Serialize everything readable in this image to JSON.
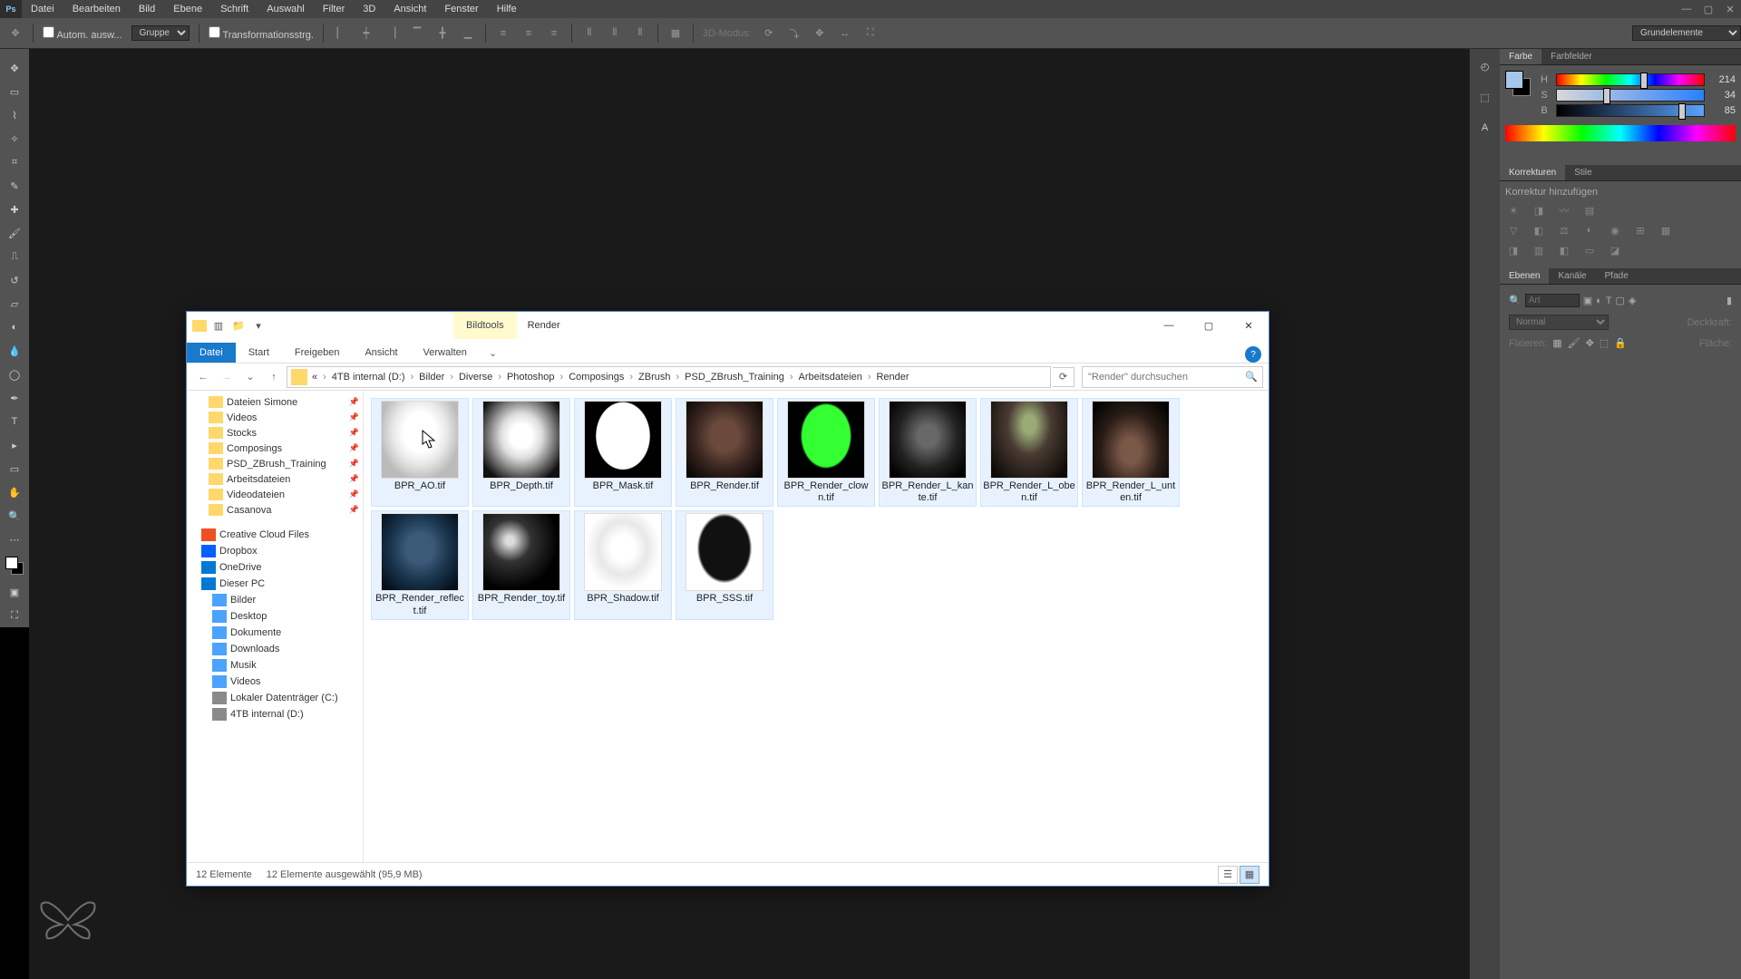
{
  "ps": {
    "logo": "Ps",
    "menu": [
      "Datei",
      "Bearbeiten",
      "Bild",
      "Ebene",
      "Schrift",
      "Auswahl",
      "Filter",
      "3D",
      "Ansicht",
      "Fenster",
      "Hilfe"
    ],
    "opt_auto": "Autom. ausw...",
    "opt_group": "Gruppe",
    "opt_trans": "Transformationsstrg.",
    "opt_3d": "3D-Modus:",
    "opt_preset": "Grundelemente",
    "color_tab": "Farbe",
    "swatch_tab": "Farbfelder",
    "h": {
      "lbl": "H",
      "val": "214"
    },
    "s": {
      "lbl": "S",
      "val": "34"
    },
    "b": {
      "lbl": "B",
      "val": "85"
    },
    "adj_tab": "Korrekturen",
    "styles_tab": "Stile",
    "adj_add": "Korrektur hinzufügen",
    "layers_tab": "Ebenen",
    "channels_tab": "Kanäle",
    "paths_tab": "Pfade",
    "search_ph": "Art",
    "blend": "Normal",
    "opacity_lbl": "Deckkraft:",
    "lock_lbl": "Fixieren:",
    "fill_lbl": "Fläche:"
  },
  "ex": {
    "tooltab": "Bildtools",
    "title": "Render",
    "ribbon_file": "Datei",
    "ribbon": [
      "Start",
      "Freigeben",
      "Ansicht"
    ],
    "ribbon_tool": "Verwalten",
    "crumbs_pre": "«",
    "crumbs": [
      "4TB internal (D:)",
      "Bilder",
      "Diverse",
      "Photoshop",
      "Composings",
      "ZBrush",
      "PSD_ZBrush_Training",
      "Arbeitsdateien",
      "Render"
    ],
    "search_ph": "\"Render\" durchsuchen",
    "tree": [
      {
        "ind": 16,
        "ico": "f",
        "label": "Dateien Simone",
        "pin": true
      },
      {
        "ind": 16,
        "ico": "f",
        "label": "Videos",
        "pin": true
      },
      {
        "ind": 16,
        "ico": "f",
        "label": "Stocks",
        "pin": true
      },
      {
        "ind": 16,
        "ico": "f",
        "label": "Composings",
        "pin": true
      },
      {
        "ind": 16,
        "ico": "f",
        "label": "PSD_ZBrush_Training",
        "pin": true
      },
      {
        "ind": 16,
        "ico": "f",
        "label": "Arbeitsdateien",
        "pin": true
      },
      {
        "ind": 16,
        "ico": "f",
        "label": "Videodateien",
        "pin": true
      },
      {
        "ind": 16,
        "ico": "f",
        "label": "Casanova",
        "pin": true
      },
      {
        "ind": 8,
        "ico": "cc",
        "label": "Creative Cloud Files"
      },
      {
        "ind": 8,
        "ico": "db",
        "label": "Dropbox"
      },
      {
        "ind": 8,
        "ico": "od",
        "label": "OneDrive"
      },
      {
        "ind": 8,
        "ico": "pc",
        "label": "Dieser PC"
      },
      {
        "ind": 20,
        "ico": "lib",
        "label": "Bilder"
      },
      {
        "ind": 20,
        "ico": "lib",
        "label": "Desktop"
      },
      {
        "ind": 20,
        "ico": "lib",
        "label": "Dokumente"
      },
      {
        "ind": 20,
        "ico": "lib",
        "label": "Downloads"
      },
      {
        "ind": 20,
        "ico": "lib",
        "label": "Musik"
      },
      {
        "ind": 20,
        "ico": "lib",
        "label": "Videos"
      },
      {
        "ind": 20,
        "ico": "drv",
        "label": "Lokaler Datenträger (C:)"
      },
      {
        "ind": 20,
        "ico": "drv",
        "label": "4TB internal (D:)"
      }
    ],
    "files": [
      {
        "n": "BPR_AO.tif",
        "c": "th-ao"
      },
      {
        "n": "BPR_Depth.tif",
        "c": "th-depth"
      },
      {
        "n": "BPR_Mask.tif",
        "c": "th-mask"
      },
      {
        "n": "BPR_Render.tif",
        "c": "th-render"
      },
      {
        "n": "BPR_Render_clown.tif",
        "c": "th-clown"
      },
      {
        "n": "BPR_Render_L_kante.tif",
        "c": "th-edge"
      },
      {
        "n": "BPR_Render_L_oben.tif",
        "c": "th-top"
      },
      {
        "n": "BPR_Render_L_unten.tif",
        "c": "th-bottom"
      },
      {
        "n": "BPR_Render_reflect.tif",
        "c": "th-reflect"
      },
      {
        "n": "BPR_Render_toy.tif",
        "c": "th-toy"
      },
      {
        "n": "BPR_Shadow.tif",
        "c": "th-shadow"
      },
      {
        "n": "BPR_SSS.tif",
        "c": "th-sss"
      }
    ],
    "status_count": "12 Elemente",
    "status_sel": "12 Elemente ausgewählt (95,9 MB)"
  }
}
